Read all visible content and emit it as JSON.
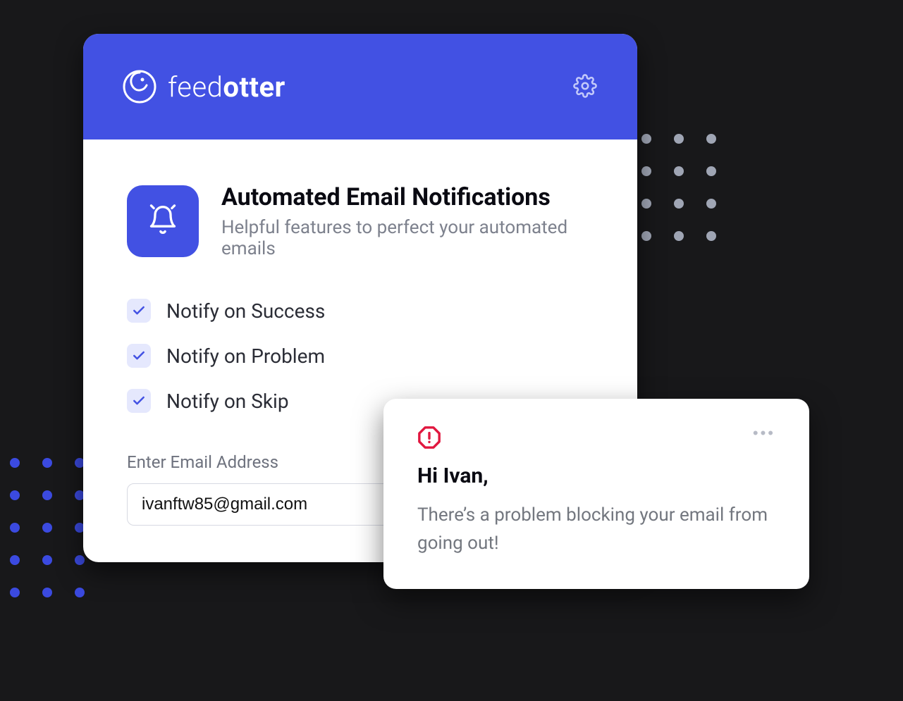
{
  "brand": {
    "name_thin": "feed",
    "name_bold": "otter"
  },
  "colors": {
    "accent": "#4251e3",
    "danger": "#e1173f"
  },
  "section": {
    "title": "Automated Email Notifications",
    "subtitle": "Helpful features to perfect your automated emails"
  },
  "options": [
    {
      "label": "Notify on Success",
      "checked": true
    },
    {
      "label": "Notify on Problem",
      "checked": true
    },
    {
      "label": "Notify on Skip",
      "checked": true
    }
  ],
  "email_field": {
    "label": "Enter Email Address",
    "value": "ivanftw85@gmail.com"
  },
  "popup": {
    "greeting": "Hi Ivan,",
    "body": "There’s a problem blocking your email from going out!"
  }
}
